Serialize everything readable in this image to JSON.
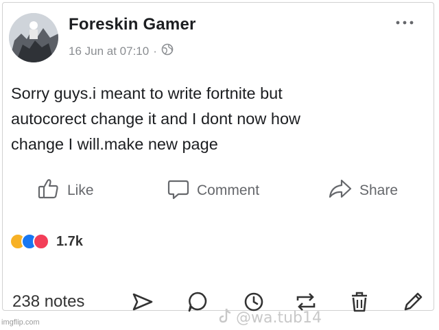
{
  "post": {
    "author_name": "Foreskin Gamer",
    "timestamp": "16 Jun at 07:10",
    "meta_separator": "·",
    "privacy_icon": "globe-icon",
    "body": "Sorry guys.i meant to write fortnite but\nautocorect change it and I dont now how\nchange I will.make new page"
  },
  "actions": {
    "like_label": "Like",
    "comment_label": "Comment",
    "share_label": "Share"
  },
  "reactions": {
    "icons": [
      "haha-reaction-icon",
      "like-reaction-icon",
      "love-reaction-icon"
    ],
    "count": "1.7k"
  },
  "bottom_bar": {
    "notes_count": "238 notes",
    "icons": [
      "send-icon",
      "reply-icon",
      "history-icon",
      "reblog-icon",
      "delete-icon",
      "edit-icon"
    ]
  },
  "watermarks": {
    "tiktok_handle": "@wa.tub14",
    "imgflip": "imgflip.com"
  },
  "colors": {
    "text": "#1c1e21",
    "muted": "#65676b",
    "haha": "#f7b125",
    "like": "#1877f2",
    "love": "#f33e58"
  }
}
